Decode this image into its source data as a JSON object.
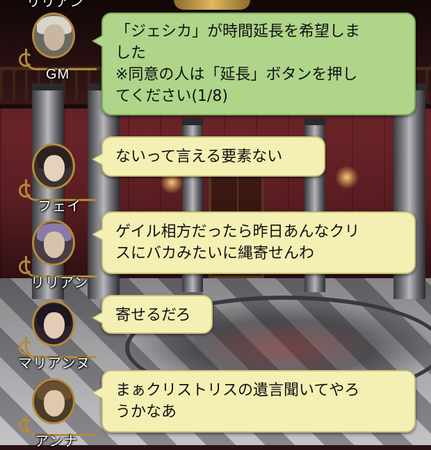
{
  "chat": {
    "top_partial_name": "リリアン",
    "messages": [
      {
        "speaker": "GM",
        "role": "gm",
        "lines": [
          "「ジェシカ」が時間延長を希望しま",
          "した",
          "※同意の人は「延長」ボタンを押し",
          "てください(1/8)"
        ]
      },
      {
        "speaker": "フェイ",
        "role": "player",
        "lines": [
          "ないって言える要素ない"
        ]
      },
      {
        "speaker": "リリアン",
        "role": "player",
        "lines": [
          "ゲイル相方だったら昨日あんなクリ",
          "スにバカみたいに縄寄せんわ"
        ]
      },
      {
        "speaker": "マリアンヌ",
        "role": "player",
        "lines": [
          "寄せるだろ"
        ]
      },
      {
        "speaker": "アンナ",
        "role": "player",
        "lines": [
          "まぁクリストリスの遺言聞いてやろ",
          "うかなあ"
        ]
      }
    ]
  },
  "colors": {
    "gm_bubble": "#aed58a",
    "player_bubble": "#f4f0b4",
    "frame_gold": "#b48a3a"
  }
}
